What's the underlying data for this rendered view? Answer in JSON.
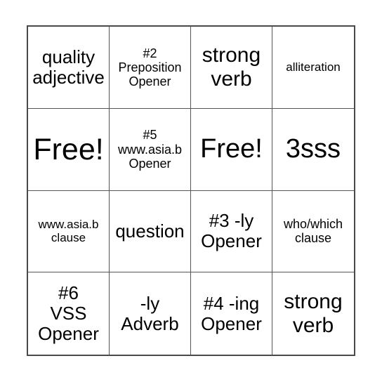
{
  "card": {
    "type": "bingo-card",
    "rows": 4,
    "columns": 4,
    "border_color": "#4a4a4a",
    "grid_line_color": "#555555",
    "background_color": "#ffffff",
    "text_color": "#000000",
    "cells": [
      {
        "text": "quality\nadjective",
        "size": "md"
      },
      {
        "text": "#2\nPreposition\nOpener",
        "size": "sm"
      },
      {
        "text": "strong\nverb",
        "size": "lg"
      },
      {
        "text": "alliteration",
        "size": "xs"
      },
      {
        "text": "Free!",
        "size": "xxl"
      },
      {
        "text": "#5\nwww.asia.b\nOpener",
        "size": "sm"
      },
      {
        "text": "Free!",
        "size": "xl"
      },
      {
        "text": "3sss",
        "size": "xl"
      },
      {
        "text": "www.asia.b\nclause",
        "size": "xs"
      },
      {
        "text": "question",
        "size": "md"
      },
      {
        "text": "#3 -ly\nOpener",
        "size": "md"
      },
      {
        "text": "who/which\nclause",
        "size": "sm"
      },
      {
        "text": "#6\nVSS\nOpener",
        "size": "md"
      },
      {
        "text": "-ly\nAdverb",
        "size": "md"
      },
      {
        "text": "#4 -ing\nOpener",
        "size": "md"
      },
      {
        "text": "strong\nverb",
        "size": "lg"
      }
    ]
  }
}
